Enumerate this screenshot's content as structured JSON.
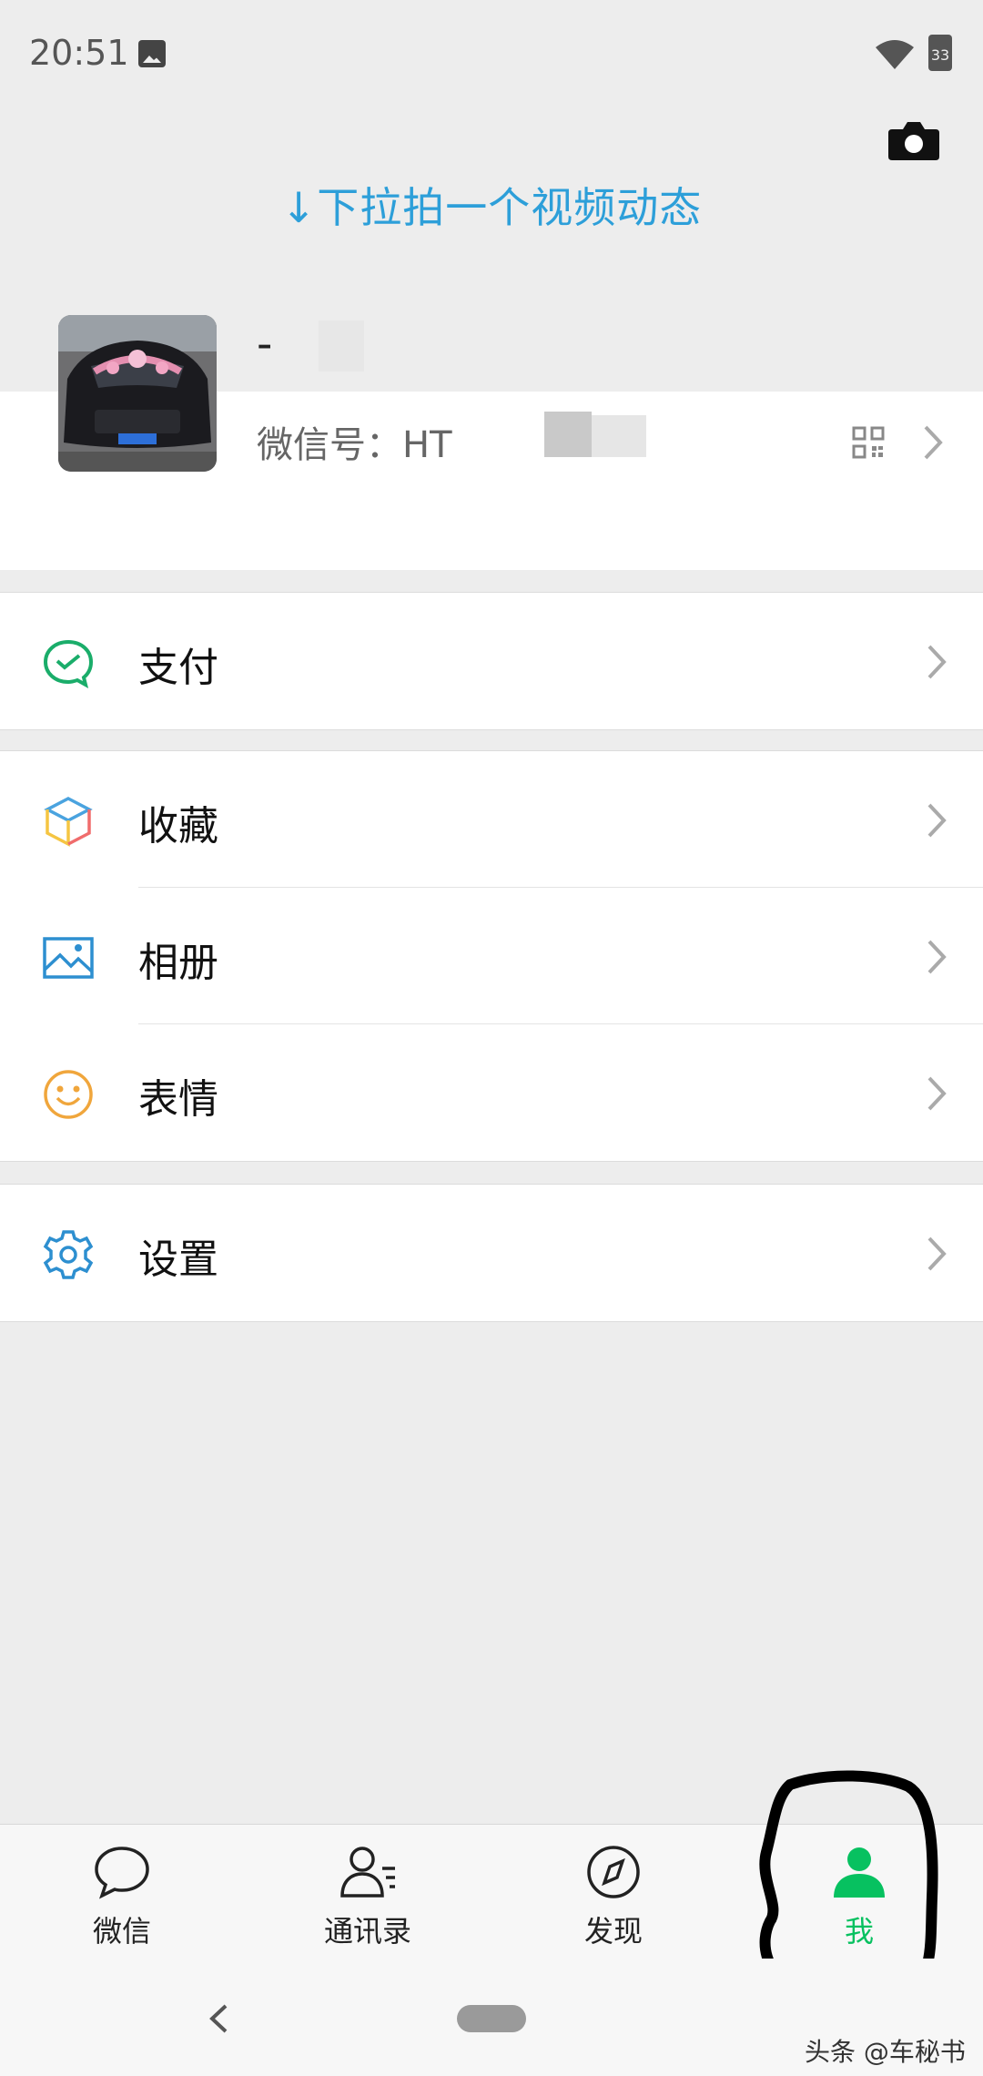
{
  "status_bar": {
    "time": "20:51",
    "battery": "33"
  },
  "header": {
    "pull_hint": "↓下拉拍一个视频动态"
  },
  "profile": {
    "nickname": "-",
    "wechat_id": "微信号：HT"
  },
  "menu": [
    {
      "label": "支付",
      "icon": "wechat-pay-icon"
    },
    {
      "label": "收藏",
      "icon": "favorites-cube-icon"
    },
    {
      "label": "相册",
      "icon": "album-icon"
    },
    {
      "label": "表情",
      "icon": "sticker-smile-icon"
    },
    {
      "label": "设置",
      "icon": "gear-icon"
    }
  ],
  "tabbar": [
    {
      "label": "微信",
      "icon": "chat-bubble-icon",
      "active": false
    },
    {
      "label": "通讯录",
      "icon": "contacts-icon",
      "active": false
    },
    {
      "label": "发现",
      "icon": "compass-icon",
      "active": false
    },
    {
      "label": "我",
      "icon": "person-icon",
      "active": true
    }
  ],
  "watermark": "头条 @车秘书",
  "colors": {
    "accent": "#07c160",
    "hint": "#2d9fd9",
    "background": "#ededed"
  }
}
